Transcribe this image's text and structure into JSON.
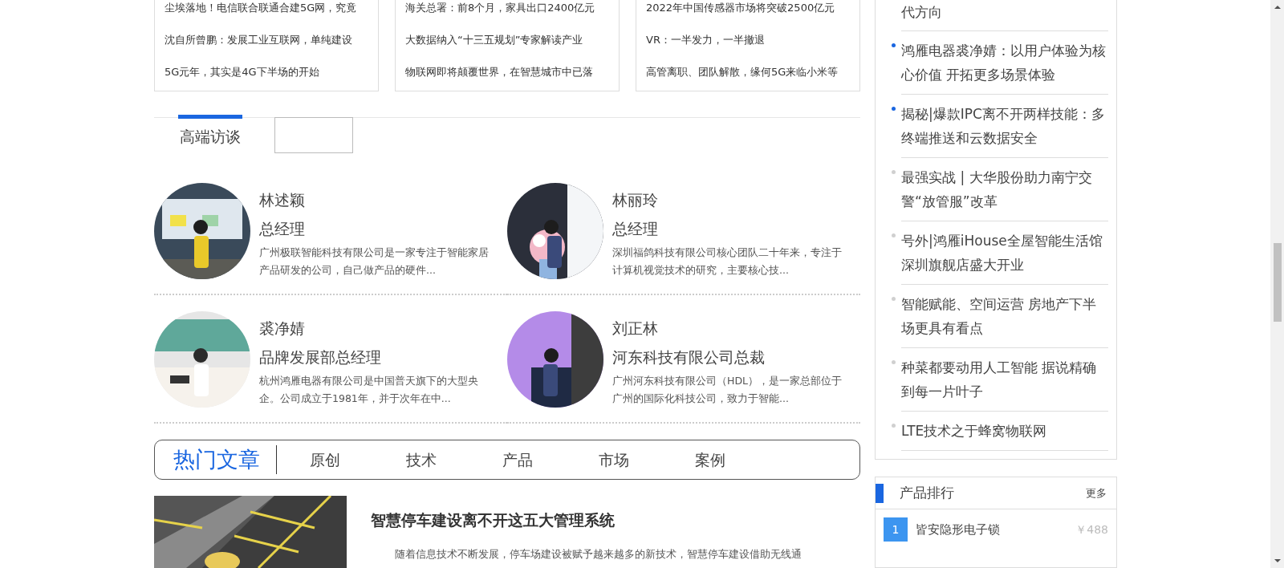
{
  "news_cards": [
    {
      "lines": [
        "尘埃落地！电信联合联通合建5G网，究竟",
        "沈自所曾鹏：发展工业互联网，单纯建设",
        "5G元年，其实是4G下半场的开始"
      ]
    },
    {
      "lines": [
        "海关总署：前8个月，家具出口2400亿元",
        "大数据纳入“十三五规划”专家解读产业",
        "物联网即将颠覆世界，在智慧城市中已落"
      ]
    },
    {
      "lines": [
        "2022年中国传感器市场将突破2500亿元",
        "VR：一半发力，一半撤退",
        "高管离职、团队解散，缘何5G来临小米等"
      ]
    }
  ],
  "interview_tabs": [
    {
      "label": "高端访谈",
      "selected": true
    }
  ],
  "interviews": [
    {
      "name": "林述颖",
      "title": "总经理",
      "summary": "广州极联智能科技有限公司是一家专注于智能家居产品研发的公司，自己做产品的硬件..."
    },
    {
      "name": "林丽玲",
      "title": "总经理",
      "summary": "深圳福鸽科技有限公司核心团队二十年来，专注于计算机视觉技术的研究，主要核心技..."
    },
    {
      "name": "裘净婧",
      "title": "品牌发展部总经理",
      "summary": "杭州鸿雁电器有限公司是中国普天旗下的大型央企。公司成立于1981年，并于次年在中..."
    },
    {
      "name": "刘正林",
      "title": "河东科技有限公司总裁",
      "summary": "广州河东科技有限公司（HDL），是一家总部位于广州的国际化科技公司，致力于智能..."
    }
  ],
  "hot_articles": {
    "title": "热门文章",
    "tabs": [
      {
        "label": "原创",
        "selected": false
      },
      {
        "label": "技术",
        "selected": false
      },
      {
        "label": "产品",
        "selected": false
      },
      {
        "label": "市场",
        "selected": false
      },
      {
        "label": "案例",
        "selected": false
      }
    ]
  },
  "article": {
    "title": "智慧停车建设离不开这五大管理系统",
    "excerpt": "随着信息技术不断发展，停车场建设被赋予越来越多的新技术，智慧停车建设借助无线通"
  },
  "sidebar_news": [
    {
      "text": "代方向"
    },
    {
      "text": "鸿雁电器裘净婧：以用户体验为核心价值 开拓更多场景体验",
      "color": "#1a66e0"
    },
    {
      "text": "揭秘|爆款IPC离不开两样技能：多终端推送和云数据安全",
      "color": "#1a66e0"
    },
    {
      "text": "最强实战 | 大华股份助力南宁交警“放管服”改革",
      "color": "#d0d0d0"
    },
    {
      "text": "号外|鸿雁iHouse全屋智能生活馆深圳旗舰店盛大开业",
      "color": "#d0d0d0"
    },
    {
      "text": "智能赋能、空间运营 房地产下半场更具有看点",
      "color": "#d0d0d0"
    },
    {
      "text": "种菜都要动用人工智能 据说精确到每一片叶子",
      "color": "#d0d0d0"
    },
    {
      "text": "LTE技术之于蜂窝物联网",
      "color": "#d0d0d0"
    }
  ],
  "product_ranking": {
    "title": "产品排行",
    "more": "更多",
    "items": [
      {
        "rank": "1",
        "name": "皆安隐形电子锁",
        "price": "￥488"
      }
    ]
  }
}
